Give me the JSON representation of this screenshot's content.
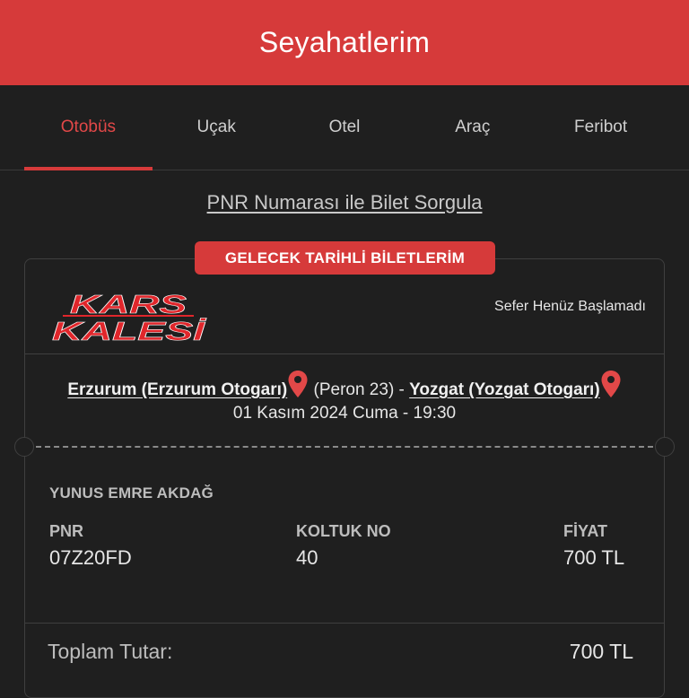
{
  "header": {
    "title": "Seyahatlerim"
  },
  "tabs": [
    {
      "label": "Otobüs",
      "active": true
    },
    {
      "label": "Uçak",
      "active": false
    },
    {
      "label": "Otel",
      "active": false
    },
    {
      "label": "Araç",
      "active": false
    },
    {
      "label": "Feribot",
      "active": false
    }
  ],
  "pnr_query_link": "PNR Numarası ile Bilet Sorgula",
  "section_badge": "GELECEK TARİHLİ BİLETLERİM",
  "ticket": {
    "company_logo_text": [
      "KARS",
      "KALESİ"
    ],
    "status": "Sefer Henüz Başlamadı",
    "origin": "Erzurum (Erzurum Otogarı)",
    "platform": "(Peron 23) -",
    "destination": "Yozgat (Yozgat Otogarı)",
    "datetime": "01 Kasım 2024 Cuma - 19:30",
    "passenger": "YUNUS EMRE AKDAĞ",
    "pnr_label": "PNR",
    "pnr_value": "07Z20FD",
    "seat_label": "KOLTUK NO",
    "seat_value": "40",
    "price_label": "FİYAT",
    "price_value": "700 TL"
  },
  "total": {
    "label": "Toplam Tutar:",
    "value": "700 TL"
  },
  "colors": {
    "brand_red": "#d63a3a",
    "background": "#1f1f1f",
    "pin": "#e24848"
  }
}
